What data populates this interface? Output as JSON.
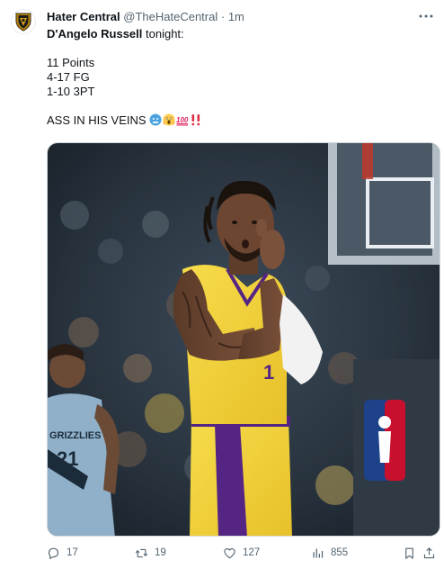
{
  "tweet": {
    "author_name": "Hater Central",
    "author_handle": "@TheHateCentral",
    "separator": "·",
    "time": "1m",
    "line1_bold": "D'Angelo Russell",
    "line1_rest": " tonight:",
    "stat1": "11 Points",
    "stat2": "4-17 FG",
    "stat3": "1-10 3PT",
    "closing_text": "ASS IN HIS VEINS ",
    "emojis": [
      "cold-face-emoji",
      "screaming-face-emoji",
      "hundred-points-emoji",
      "double-exclamation-emoji"
    ]
  },
  "media": {
    "icon": "photo",
    "jersey_number_main": "1",
    "jersey_number_background": "21",
    "background_jersey_text": "GRIZZLIES"
  },
  "actions": {
    "reply_count": "17",
    "retweet_count": "19",
    "like_count": "127",
    "views_count": "855"
  },
  "colors": {
    "text_primary": "#0f1419",
    "text_secondary": "#536471",
    "lakers_gold": "#f4d03f",
    "lakers_purple": "#552583"
  }
}
